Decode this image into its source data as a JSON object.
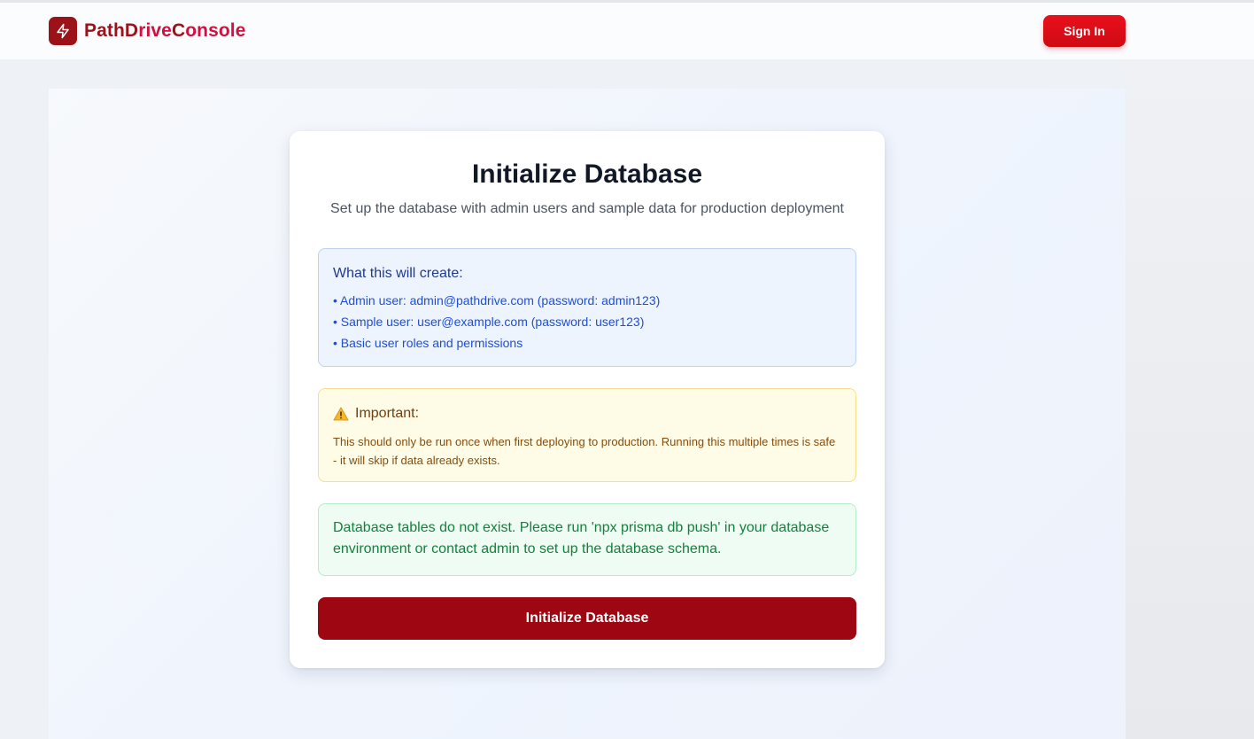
{
  "header": {
    "logo_part1": "Path",
    "logo_part2": "D",
    "logo_part3": "rive",
    "logo_part4": "C",
    "logo_part5": "onsole",
    "sign_in_label": "Sign In"
  },
  "card": {
    "title": "Initialize Database",
    "subtitle": "Set up the database with admin users and sample data for production deployment",
    "info": {
      "title": "What this will create:",
      "items": [
        "• Admin user: admin@pathdrive.com (password: admin123)",
        "• Sample user: user@example.com (password: user123)",
        "• Basic user roles and permissions"
      ]
    },
    "warning": {
      "title": "Important:",
      "body": "This should only be run once when first deploying to production. Running this multiple times is safe - it will skip if data already exists."
    },
    "status": {
      "message": "Database tables do not exist. Please run 'npx prisma db push' in your database environment or contact admin to set up the database schema."
    },
    "button_label": "Initialize Database"
  },
  "colors": {
    "brand_dark": "#9b1218",
    "brand_accent": "#d1103f",
    "sign_in_bg": "#e8101c",
    "primary_button": "#9e0612",
    "success_text": "#15803d",
    "info_text": "#1d4ed8",
    "warning_text": "#854d0e"
  },
  "icons": {
    "logo": "lightning-icon",
    "warning": "warning-triangle-icon"
  }
}
